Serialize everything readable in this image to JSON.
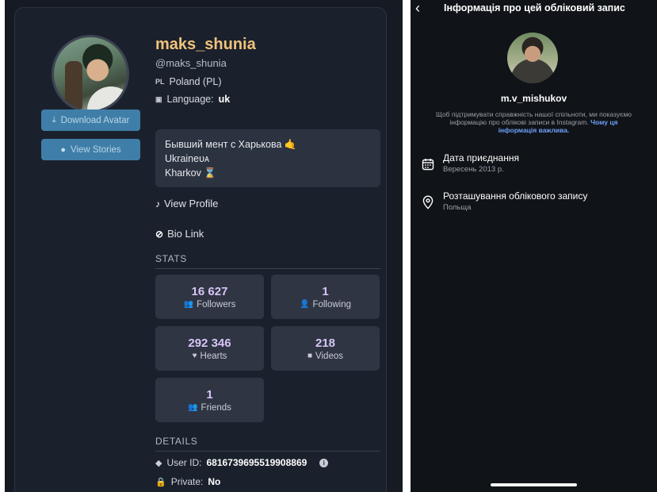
{
  "left": {
    "username": "maks_shunia",
    "handle": "@maks_shunia",
    "country_tag": "PL",
    "country": "Poland (PL)",
    "language_label": "Language:",
    "language_value": "uk",
    "buttons": {
      "download_avatar": "Download Avatar",
      "view_stories": "View Stories"
    },
    "bio_lines": [
      "Бывший мент с Харькова 🤙",
      "Ukraineᴜᴀ",
      "Kharkov ⌛"
    ],
    "links": {
      "view_profile": "View Profile",
      "bio_link": "Bio Link"
    },
    "stats_title": "STATS",
    "stats": [
      {
        "value": "16 627",
        "label": "Followers",
        "icon": "users-icon"
      },
      {
        "value": "1",
        "label": "Following",
        "icon": "user-plus-icon"
      },
      {
        "value": "292 346",
        "label": "Hearts",
        "icon": "heart-icon"
      },
      {
        "value": "218",
        "label": "Videos",
        "icon": "video-icon"
      },
      {
        "value": "1",
        "label": "Friends",
        "icon": "friends-icon"
      }
    ],
    "details_title": "DETAILS",
    "details": {
      "user_id_label": "User ID:",
      "user_id_value": "6816739695519908869",
      "private_label": "Private:",
      "private_value": "No"
    }
  },
  "right": {
    "title": "Інформація про цей обліковий запис",
    "username": "m.v_mishukov",
    "description": "Щоб підтримувати справжність нашої спільноти, ми показуємо інформацію про облікові записи в Instagram.",
    "description_link": "Чому ця інформація важлива.",
    "items": [
      {
        "title": "Дата приєднання",
        "value": "Вересень 2013 р.",
        "icon": "calendar-icon"
      },
      {
        "title": "Розташування облікового запису",
        "value": "Польща",
        "icon": "location-pin-icon"
      }
    ]
  },
  "colors": {
    "left_bg": "#151a23",
    "card_bg": "#1b212c",
    "username": "#f0c27c",
    "button": "#3f7ea8",
    "stat_number": "#d7c5f7",
    "right_bg": "#101318",
    "link_blue": "#6e9ff7"
  }
}
